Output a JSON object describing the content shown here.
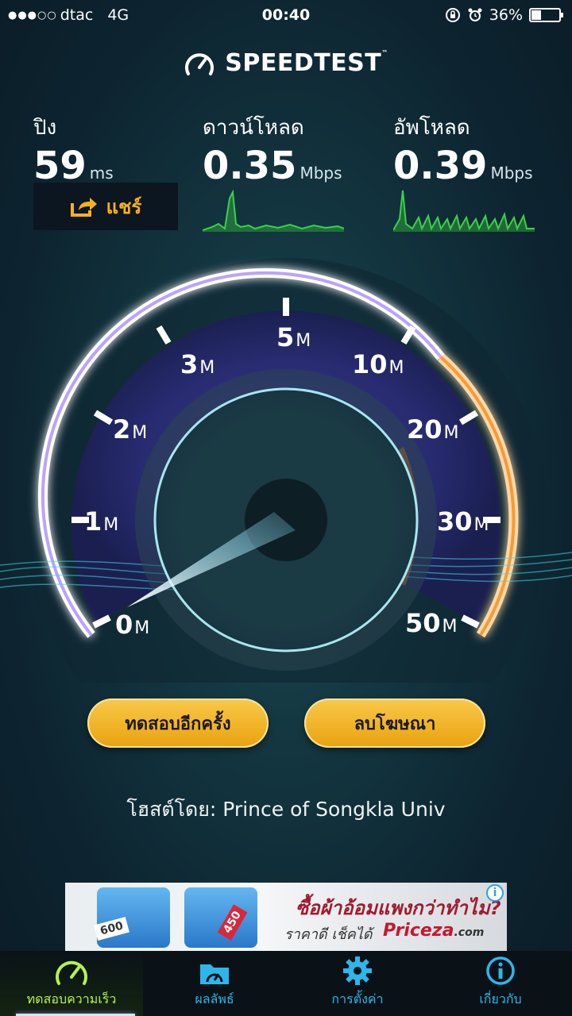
{
  "status_bar": {
    "signal_dots": "●●●○○",
    "carrier": "dtac",
    "network": "4G",
    "time": "00:40",
    "battery": "36%",
    "battery_level": 0.36
  },
  "app": {
    "title": "SPEEDTEST",
    "trademark": "™"
  },
  "metrics": {
    "ping": {
      "label": "ปิง",
      "value": "59",
      "unit": "ms"
    },
    "download": {
      "label": "ดาวน์โหลด",
      "value": "0.35",
      "unit": "Mbps"
    },
    "upload": {
      "label": "อัพโหลด",
      "value": "0.39",
      "unit": "Mbps"
    }
  },
  "share_label": "แชร์",
  "gauge": {
    "labels": [
      {
        "num": "0",
        "unit": "M"
      },
      {
        "num": "1",
        "unit": "M"
      },
      {
        "num": "2",
        "unit": "M"
      },
      {
        "num": "3",
        "unit": "M"
      },
      {
        "num": "5",
        "unit": "M"
      },
      {
        "num": "10",
        "unit": "M"
      },
      {
        "num": "20",
        "unit": "M"
      },
      {
        "num": "30",
        "unit": "M"
      },
      {
        "num": "50",
        "unit": "M"
      }
    ],
    "needle_value_mbps": 0.35
  },
  "buttons": {
    "retest": "ทดสอบอีกครั้ง",
    "remove_ads": "ลบโฆษณา"
  },
  "host": {
    "prefix": "โฮสต์โดย:",
    "name": "Prince of Songkla Univ"
  },
  "ad": {
    "headline": "ซื้อผ้าอ้อมแพงกว่าทำไม?",
    "subline": "ราคาดี เช็คได้",
    "brand": "Priceza",
    "brand_suffix": ".com",
    "price_1": "600",
    "price_2": "450",
    "info": "i"
  },
  "tabs": [
    {
      "label": "ทดสอบความเร็ว",
      "icon": "speedometer-icon",
      "active": true
    },
    {
      "label": "ผลลัพธ์",
      "icon": "results-folder-icon",
      "active": false
    },
    {
      "label": "การตั้งค่า",
      "icon": "gear-icon",
      "active": false
    },
    {
      "label": "เกี่ยวกับ",
      "icon": "info-icon",
      "active": false
    }
  ],
  "colors": {
    "accent": "#f5b21f",
    "tab_active": "#b7f14d",
    "tab_inactive": "#2eb6ea",
    "graph": "#3ad24a",
    "gauge_purple": "#8a5cf5",
    "gauge_orange": "#f7922a"
  }
}
